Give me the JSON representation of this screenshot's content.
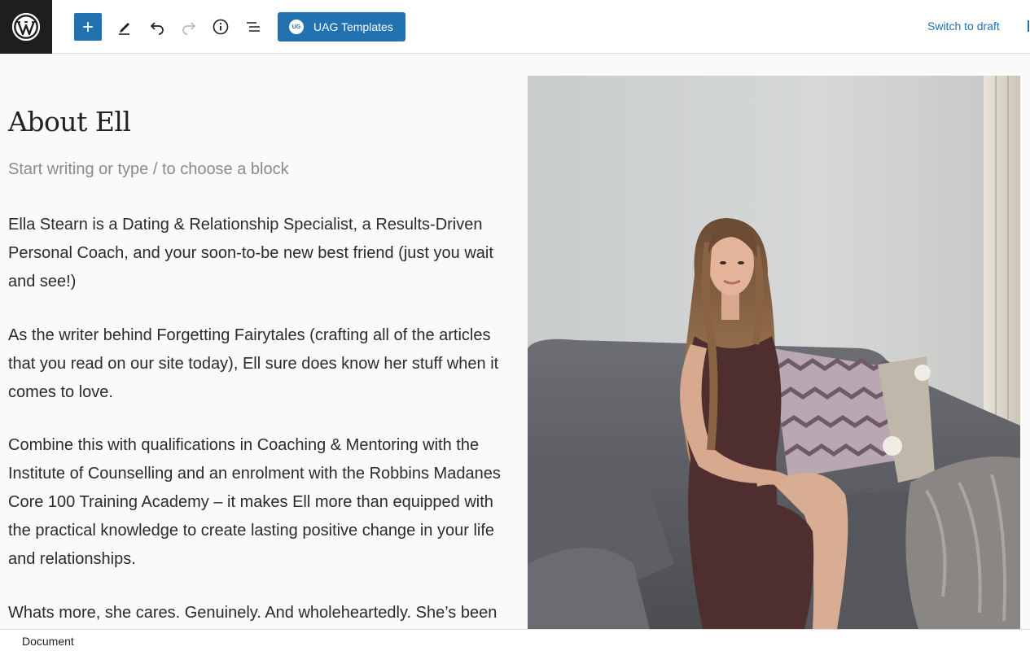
{
  "toolbar": {
    "logo_icon": "wordpress-icon",
    "add_icon": "plus-icon",
    "tools_icon": "pencil-icon",
    "undo_icon": "undo-icon",
    "redo_icon": "redo-icon",
    "details_icon": "info-icon",
    "outline_icon": "list-view-icon",
    "uag_badge": "UG",
    "uag_label": "UAG Templates",
    "switch_to_draft": "Switch to draft",
    "accent_color": "#2271b1"
  },
  "post": {
    "title": "About Ell",
    "block_placeholder": "Start writing or type / to choose a block",
    "paragraphs": [
      "Ella Stearn is a Dating & Relationship Specialist, a Results-Driven Personal Coach, and your soon-to-be new best friend (just you wait and see!)",
      "As the writer behind Forgetting Fairytales (crafting all of the articles that you read on our site today), Ell sure does know her stuff when it comes to love.",
      "Combine this with qualifications in Coaching & Mentoring with the Institute of Counselling and an enrolment with the Robbins Madanes Core 100 Training Academy – it makes Ell more than equipped with the practical knowledge to create lasting positive change in your life and relationships.",
      "Whats more, she cares. Genuinely. And wholeheartedly. She’s been"
    ]
  },
  "footer": {
    "breadcrumb": "Document"
  }
}
